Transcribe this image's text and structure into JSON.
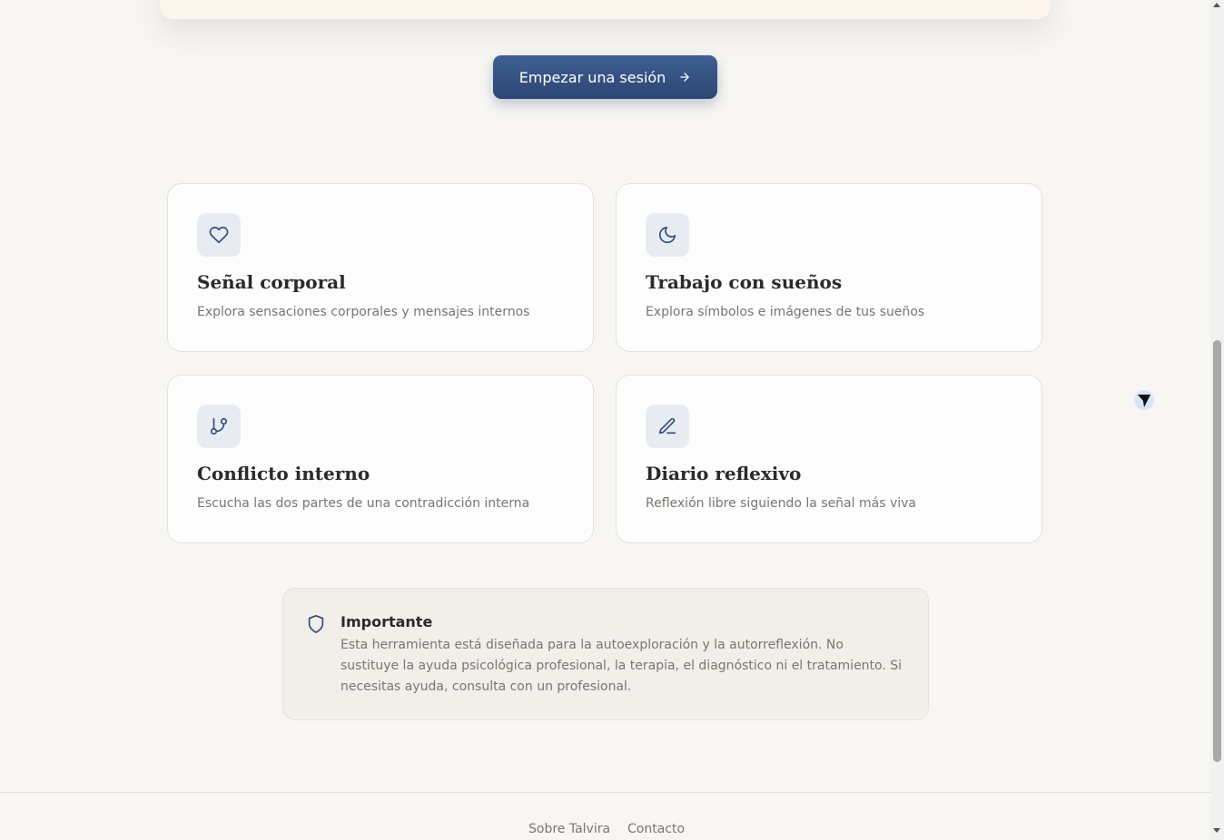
{
  "hero": {
    "cta_label": "Empezar una sesión",
    "cta_icon": "arrow-right-icon"
  },
  "cards": [
    {
      "title": "Señal corporal",
      "description": "Explora sensaciones corporales y mensajes internos",
      "icon": "heart-icon"
    },
    {
      "title": "Trabajo con sueños",
      "description": "Explora símbolos e imágenes de tus sueños",
      "icon": "moon-icon"
    },
    {
      "title": "Conflicto interno",
      "description": "Escucha las dos partes de una contradicción interna",
      "icon": "git-branch-icon"
    },
    {
      "title": "Diario reflexivo",
      "description": "Reflexión libre siguiendo la señal más viva",
      "icon": "pen-icon"
    }
  ],
  "notice": {
    "title": "Importante",
    "text": "Esta herramienta está diseñada para la autoexploración y la autorreflexión. No sustituye la ayuda psicológica profesional, la terapia, el diagnóstico ni el tratamiento. Si necesitas ayuda, consulta con un profesional.",
    "icon": "shield-icon"
  },
  "footer": {
    "links": [
      "Sobre Talvira",
      "Contacto"
    ]
  },
  "colors": {
    "accent": "#2f4b7c",
    "background": "#f8f6f3",
    "icon_bg": "#e8ecf2"
  }
}
